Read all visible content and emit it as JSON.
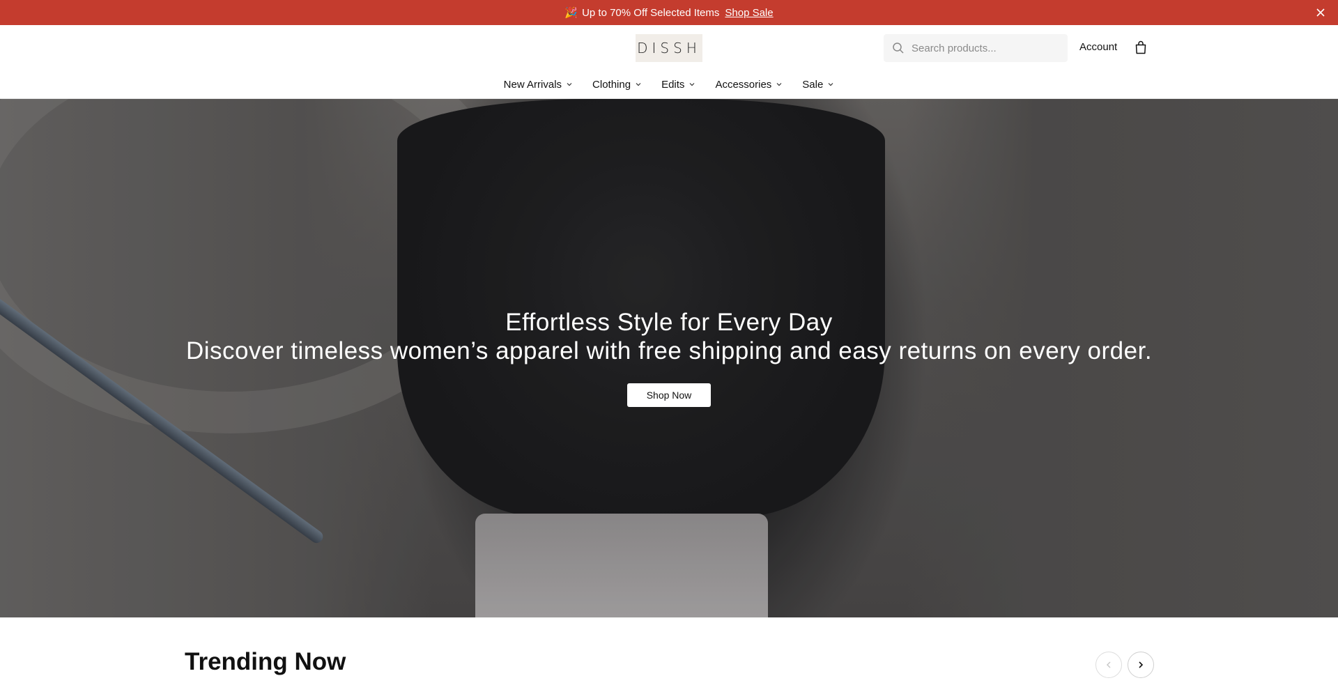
{
  "announcement": {
    "emoji": "🎉",
    "message": "Up to 70% Off Selected Items",
    "link_label": "Shop Sale"
  },
  "header": {
    "logo": "DISSH",
    "search_placeholder": "Search products...",
    "account_label": "Account"
  },
  "nav": {
    "items": [
      {
        "label": "New Arrivals"
      },
      {
        "label": "Clothing"
      },
      {
        "label": "Edits"
      },
      {
        "label": "Accessories"
      },
      {
        "label": "Sale"
      }
    ]
  },
  "hero": {
    "title": "Effortless Style for Every Day",
    "subtitle": "Discover timeless women’s apparel with free shipping and easy returns on every order.",
    "cta_label": "Shop Now"
  },
  "trending": {
    "title": "Trending Now"
  },
  "colors": {
    "announcement_bg": "#c43c2e",
    "logo_bg": "#f1ede8"
  },
  "icons": {
    "search": "search-icon",
    "bag": "shopping-bag-icon",
    "close": "close-icon",
    "chevron": "chevron-down-icon",
    "prev": "chevron-left-icon",
    "next": "chevron-right-icon"
  }
}
